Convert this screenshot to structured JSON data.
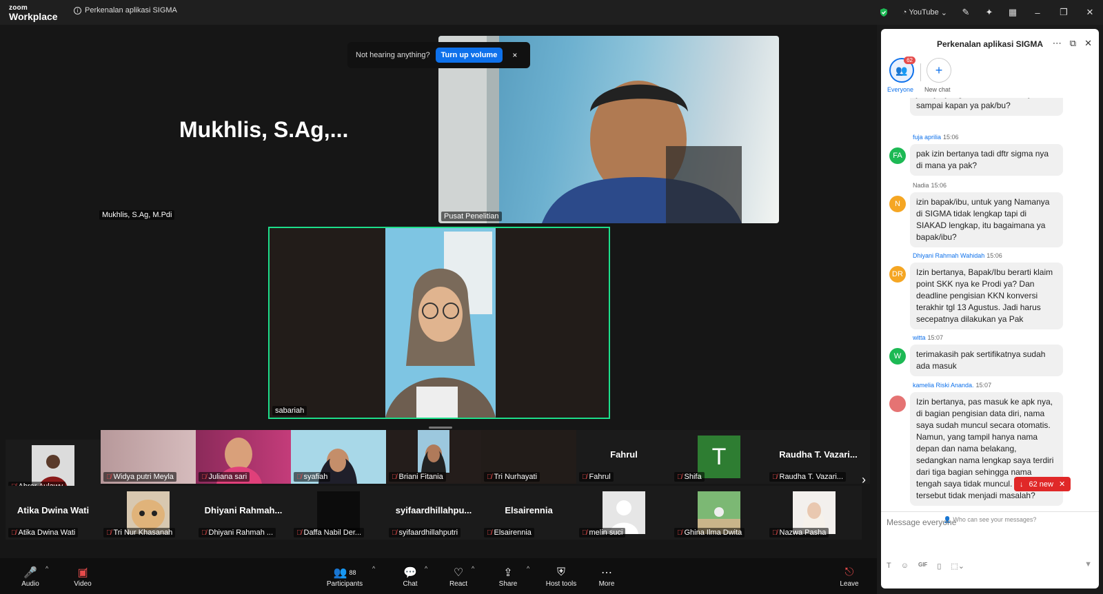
{
  "titlebar": {
    "logo_top": "zoom",
    "logo_bottom": "Workplace",
    "meeting_title": "Perkenalan aplikasi SIGMA",
    "youtube": "YouTube"
  },
  "speaker": {
    "big_name": "Mukhlis,  S.Ag,...",
    "label": "Mukhlis, S.Ag, M.Pdi"
  },
  "toast": {
    "text": "Not hearing anything?",
    "button": "Turn up volume",
    "close": "×"
  },
  "tiles": {
    "main_video_label": "Pusat Penelitian",
    "active_label": "sabariah"
  },
  "strip": {
    "row1": [
      "Abror Aulawy",
      "Widya putri Meyla",
      "Juliana sari",
      "syafiah",
      "Briani Fitania",
      "Tri Nurhayati",
      "Fahrul",
      "Shifa",
      "Raudha T. Vazari..."
    ],
    "row1_big": {
      "fahrul": "Fahrul",
      "raudha": "Raudha T. Vazari...",
      "shifa_initial": "T"
    },
    "row2": [
      "Atika Dwina Wati",
      "Tri Nur Khasanah",
      "Dhiyani Rahmah ...",
      "Daffa Nabil Der...",
      "syifaardhillahputri",
      "Elsairennia",
      "melin suci",
      "Ghina Ilma Dwita",
      "Nazwa Pasha"
    ],
    "row2_big": {
      "atika": "Atika Dwina Wati",
      "dhiyani": "Dhiyani  Rahmah...",
      "syifa": "syifaardhillahpu...",
      "elsa": "Elsairennia"
    }
  },
  "controls": {
    "audio": "Audio",
    "video": "Video",
    "participants": "Participants",
    "participants_count": "88",
    "chat": "Chat",
    "react": "React",
    "share": "Share",
    "host_tools": "Host tools",
    "more": "More",
    "leave": "Leave"
  },
  "panel": {
    "title": "Perkenalan aplikasi SIGMA",
    "everyone": "Everyone",
    "everyone_badge": "62",
    "new_chat": "New chat",
    "partial_msg": "jadinya yang tahun kemarin saja atau sampai kapan ya pak/bu?",
    "messages": [
      {
        "initials": "FA",
        "name": "fuja aprilia",
        "time": "15:06",
        "text": "pak izin bertanya tadi dftr sigma nya di mana ya pak?",
        "color": "#1db954"
      },
      {
        "initials": "N",
        "name": "Nadia",
        "time": "15:06",
        "text": "izin bapak/ibu, untuk yang Namanya di SIGMA tidak lengkap tapi di SIAKAD lengkap, itu bagaimana ya bapak/ibu?",
        "color": "#f5a623"
      },
      {
        "initials": "DR",
        "name": "Dhiyani Rahmah Wahidah",
        "time": "15:06",
        "text": "Izin bertanya, Bapak/Ibu berarti klaim point SKK nya ke Prodi ya? Dan deadline pengisian KKN konversi terakhir tgl 13 Agustus. Jadi harus secepatnya dilakukan ya Pak",
        "color": "#f5a623"
      },
      {
        "initials": "W",
        "name": "witta",
        "time": "15:07",
        "text": "terimakasih pak sertifikatnya sudah ada masuk",
        "color": "#1db954"
      },
      {
        "initials": "",
        "name": "kamelia Riski Ananda.",
        "time": "15:07",
        "text": "Izin bertanya, pas masuk ke apk nya, di bagian pengisian data diri, nama saya sudah muncul secara otomatis. Namun, yang tampil hanya nama depan dan nama belakang, sedangkan nama lengkap saya terdiri dari tiga bagian sehingga nama tengah saya tidak muncul. Apakah hal tersebut tidak menjadi masalah?",
        "color": "#e57373"
      }
    ],
    "new_badge": "62 new",
    "who_can_see": "Who can see your messages?",
    "composer_placeholder": "Message everyone"
  }
}
